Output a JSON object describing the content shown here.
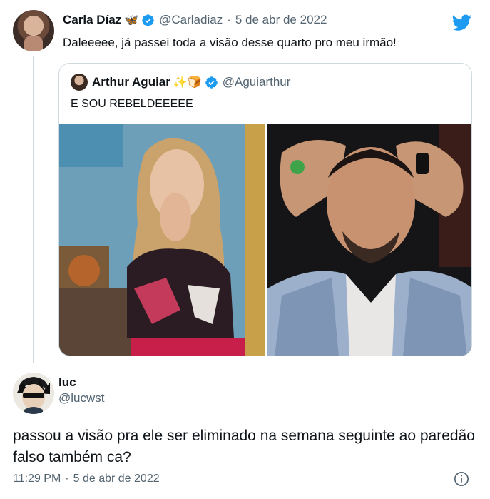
{
  "parent": {
    "display_name": "Carla Díaz",
    "emoji": "🦋",
    "handle": "@Carladiaz",
    "dot": "·",
    "date": "5 de abr de 2022",
    "text": "Daleeeee, já passei toda a visão desse quarto pro meu irmão!"
  },
  "quote": {
    "display_name": "Arthur Aguiar",
    "emoji": "✨🍞",
    "handle": "@Aguiarthur",
    "text": "E SOU REBELDEEEEE"
  },
  "reply": {
    "display_name": "luc",
    "handle": "@lucwst",
    "text": "passou a visão pra ele ser eliminado na semana seguinte ao paredão falso também ca?",
    "time": "11:29 PM",
    "dot": "·",
    "date": "5 de abr de 2022"
  },
  "colors": {
    "verified": "#1d9bf0",
    "twitter_brand": "#1d9bf0",
    "secondary_text": "#536471",
    "border": "#cfd9de"
  },
  "icons": {
    "verified": "verified-badge-icon",
    "brand": "twitter-bird-icon",
    "info": "info-icon"
  }
}
